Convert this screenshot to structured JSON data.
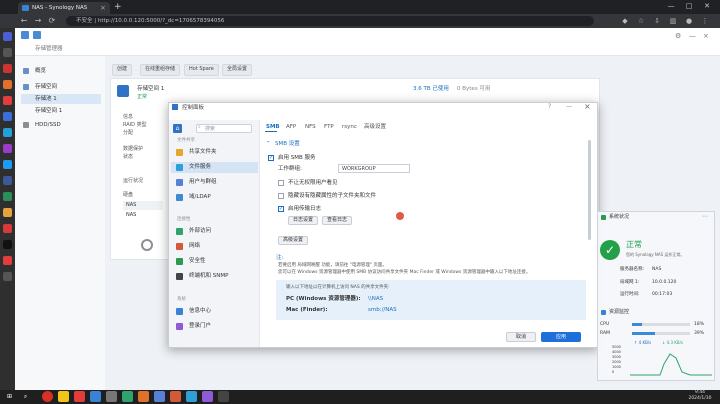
{
  "browser": {
    "tab_title": "NAS - Synology NAS",
    "url": "不安全 | http://10.0.0.120:5000/?_dc=1706578394056",
    "new_tab": "+",
    "close": "×",
    "minimize": "—",
    "maximize": "□",
    "window_close": "✕"
  },
  "dsm": {
    "app_title": "存储管理器",
    "sidebar": [
      "概览",
      "存储空间",
      "存储池 1",
      "存储空间 1",
      "HDD/SSD"
    ],
    "toolbar": [
      "创建",
      "在线重组存储",
      "Hot Spare",
      "全局设置"
    ],
    "volume_label": "存储空间 1",
    "volume_status": "正常",
    "usage_text": "3.6 TB 已使用",
    "usage_text2": "0 Bytes 可用",
    "info_labels": [
      "信息",
      "RAID 类型",
      "分配",
      "数据保护",
      "状态",
      "运行状况",
      "描述",
      "硬盘"
    ],
    "disk_values": [
      "NAS",
      "NAS"
    ]
  },
  "modal": {
    "title": "控制面板",
    "help": "?",
    "min": "—",
    "close": "×",
    "search_placeholder": "搜索",
    "sections": {
      "file_sharing": "文件共享",
      "connectivity": "连接性",
      "system": "系统"
    },
    "nav": [
      "共享文件夹",
      "文件服务",
      "用户与群组",
      "域/LDAP",
      "外部访问",
      "网络",
      "安全性",
      "终端机和 SNMP",
      "信息中心",
      "登录门户"
    ],
    "tabs": [
      "SMB",
      "AFP",
      "NFS",
      "FTP",
      "rsync",
      "高级设置"
    ],
    "smb_section": "SMB 设置",
    "enable_smb": "启用 SMB 服务",
    "workgroup_label": "工作群组:",
    "workgroup_value": "WORKGROUP",
    "opt1": "不让无权限用户看见",
    "opt2": "隐藏设有隐藏属性的子文件夹和文件",
    "opt3": "启用传输日志",
    "btn_settings": "日志设置",
    "btn_view_logs": "查看日志",
    "btn_advanced": "高级设置",
    "note_title": "注:",
    "note1": "若要启用 局域网唤醒 功能，请前往 \"电源管理\" 页面。",
    "note2": "您可以在 Windows 资源管理器中使用 SMB 协议访问共享文件夹 Mac Finder 或 Windows 资源管理器中输入以下地址连接。",
    "conn_hint": "输入以下地址以在计算机上访问 NAS 的共享文件夹:",
    "pc_label": "PC (Windows 资源管理器):",
    "pc_value": "\\\\NAS",
    "mac_label": "Mac (Finder):",
    "mac_value": "smb://NAS",
    "cancel": "取消",
    "apply": "应用"
  },
  "widgets": {
    "health_title": "系统状况",
    "health_status": "正常",
    "health_sub": "您的 Synology NAS 运作正常。",
    "rows": [
      {
        "label": "服务器名称:",
        "value": "NAS"
      },
      {
        "label": "局域网 1:",
        "value": "10.0.0.120"
      },
      {
        "label": "运行时间:",
        "value": "00:17:03"
      }
    ],
    "resource_title": "资源监控",
    "cpu_label": "CPU",
    "cpu_pct": 0.18,
    "cpu_text": "18%",
    "ram_label": "RAM",
    "ram_pct": 0.39,
    "ram_text": "39%",
    "net_up": "↑ 4 KB/s",
    "net_down": "↓ 4.3 KB/s",
    "graph_ticks": [
      "5000",
      "4000",
      "3000",
      "2000",
      "1000",
      "0"
    ]
  },
  "taskbar": {
    "time": "9:44",
    "date": "2024/1/30"
  },
  "colors": {
    "accent": "#1e6fd9",
    "healthy": "#23a049",
    "cursor": "#e05a4a"
  }
}
